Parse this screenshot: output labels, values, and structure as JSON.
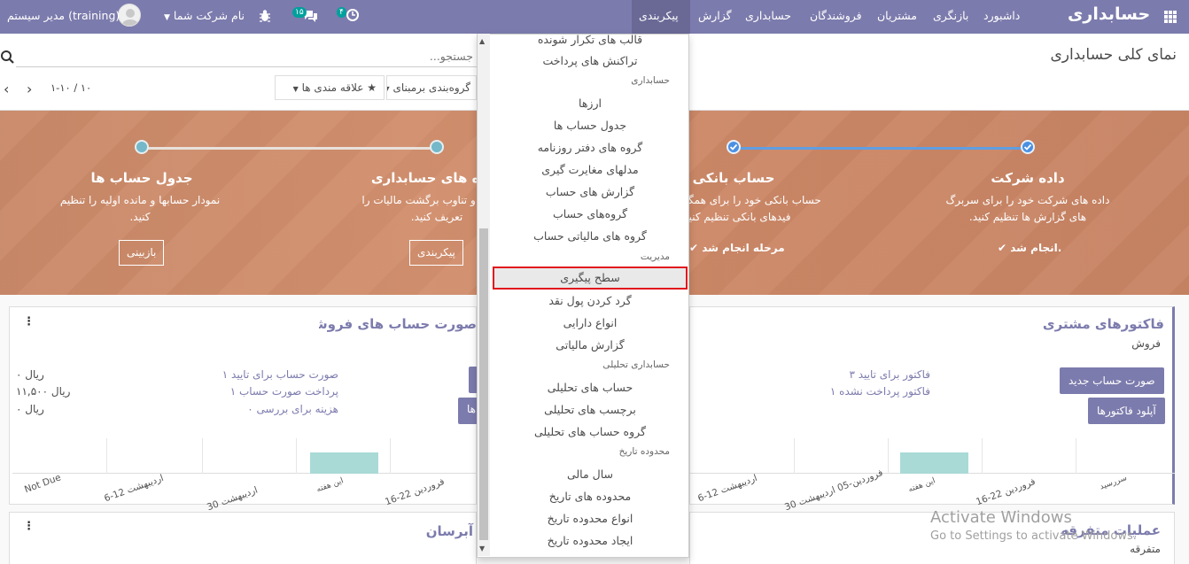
{
  "navbar": {
    "app_title": "حسابداری",
    "menu": [
      "داشبورد",
      "بازنگری",
      "مشتریان",
      "فروشندگان",
      "حسابداری",
      "گزارش",
      "پیکربندی"
    ],
    "user": "مدیر سیستم (training)",
    "company": "نام شرکت شما",
    "messages_count": "۱۵",
    "activity_count": "۴"
  },
  "control": {
    "page_title": "نمای کلی حسابداری",
    "search_placeholder": "جستجو...",
    "group_by": "گروه‌بندی برمبنای",
    "favorites": "علاقه مندی ها",
    "pager": "۱-۱۰ / ۱۰"
  },
  "steps": [
    {
      "title": "داده شرکت",
      "desc": "داده های شرکت خود را برای سربرگ های گزارش ها تنظیم کنید.",
      "status": "انجام شد."
    },
    {
      "title": "حساب بانکی",
      "desc": "حساب بانکی خود را برای همگام سازی فیدهای بانکی تنظیم کنید.",
      "status": "مرحله انجام شد"
    },
    {
      "title": "دوره های حسابداری",
      "desc": "دوره ها و تناوب برگشت مالیات را تعریف کنید.",
      "button": "پیکربندی"
    },
    {
      "title": "جدول حساب ها",
      "desc": "نمودار حسابها و مانده اولیه را تنظیم کنید.",
      "button": "بازبینی"
    }
  ],
  "customer_card": {
    "title": "فاکتورهای مشتری",
    "subtitle": "فروش",
    "btn_new": "صورت حساب جدید",
    "btn_upload": "آپلود فاکتورها",
    "stats": [
      "۳ فاکتور برای تایید",
      "۱ فاکتور پرداخت نشده"
    ],
    "axis": [
      "سررسید",
      "16-22 فروردین",
      "این هفته",
      "30 فروردین-05 اردیبهشت",
      "6-12 اردیبهشت"
    ]
  },
  "vendor_card": {
    "title": "صورت حساب های فروشنده",
    "btn_upload": "آپلود صورتحساب ها",
    "stats": [
      "۱ صورت حساب برای تایید",
      "۱ پرداخت صورت حساب",
      "۰ هزینه برای بررسی"
    ],
    "values": [
      "۰ ریال",
      "۱۱,۵۰۰ ریال",
      "۰ ریال"
    ],
    "axis": [
      "16-22 فروردین",
      "این هفته",
      "30 فروردین-05 اردیبهشت",
      "6-12 اردیبهشت",
      "Not Due"
    ]
  },
  "misc_card": {
    "title": "عملیات متفرقه",
    "subtitle": "متفرقه"
  },
  "cash_card": {
    "title": "آبرسان"
  },
  "dropdown": {
    "items": [
      {
        "type": "item",
        "label": "قالب های تکرار شونده"
      },
      {
        "type": "item",
        "label": "تراکنش های پرداخت"
      },
      {
        "type": "header",
        "label": "حسابداری"
      },
      {
        "type": "item",
        "label": "ارزها"
      },
      {
        "type": "item",
        "label": "جدول حساب ها"
      },
      {
        "type": "item",
        "label": "گروه های دفتر روزنامه"
      },
      {
        "type": "item",
        "label": "مدلهای مغایرت گیری"
      },
      {
        "type": "item",
        "label": "گزارش های حساب"
      },
      {
        "type": "item",
        "label": "گروه‌های حساب"
      },
      {
        "type": "item",
        "label": "گروه های مالیاتی حساب"
      },
      {
        "type": "header",
        "label": "مدیریت"
      },
      {
        "type": "item",
        "label": "سطح پیگیری"
      },
      {
        "type": "item",
        "label": "گرد کردن پول نقد"
      },
      {
        "type": "item",
        "label": "انواع دارایی"
      },
      {
        "type": "item",
        "label": "گزارش مالیاتی"
      },
      {
        "type": "header",
        "label": "حسابداری تحلیلی"
      },
      {
        "type": "item",
        "label": "حساب های تحلیلی"
      },
      {
        "type": "item",
        "label": "برچسب های تحلیلی"
      },
      {
        "type": "item",
        "label": "گروه حساب های تحلیلی"
      },
      {
        "type": "header",
        "label": "محدوده تاریخ"
      },
      {
        "type": "item",
        "label": "سال مالی"
      },
      {
        "type": "item",
        "label": "محدوده های تاریخ"
      },
      {
        "type": "item",
        "label": "انواع محدوده تاریخ"
      },
      {
        "type": "item",
        "label": "ایجاد محدوده تاریخ"
      }
    ]
  },
  "watermark": {
    "line1": "Activate Windows",
    "line2": "Go to Settings to activate Windows."
  },
  "colors": {
    "brand": "#7c7bad",
    "highlight": "#e0151d",
    "bar": "#a9dad6"
  }
}
